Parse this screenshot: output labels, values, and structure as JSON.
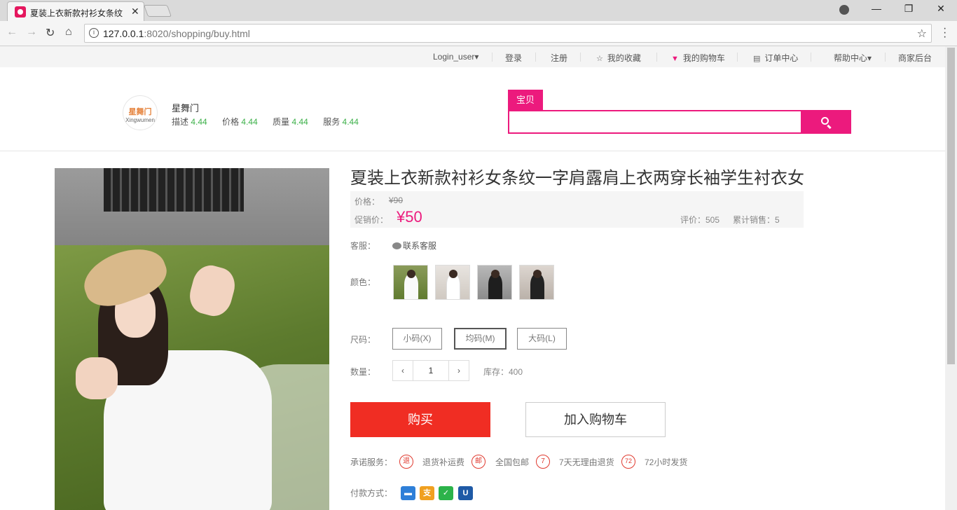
{
  "browser": {
    "tab_title": "夏装上衣新款衬衫女条纹",
    "url_host": "127.0.0.1",
    "url_path": ":8020/shopping/buy.html",
    "window_controls": {
      "minimize": "—",
      "restore": "❐",
      "close": "✕"
    }
  },
  "topnav": {
    "user": "Login_user▾",
    "login": "登录",
    "register": "注册",
    "favorites": "我的收藏",
    "cart": "我的购物车",
    "orders": "订单中心",
    "help": "帮助中心▾",
    "merchant": "商家后台"
  },
  "shop": {
    "logo_cn": "星舞门",
    "logo_en": "Xingwumen",
    "name": "星舞门",
    "ratings": [
      {
        "label": "描述",
        "value": "4.44"
      },
      {
        "label": "价格",
        "value": "4.44"
      },
      {
        "label": "质量",
        "value": "4.44"
      },
      {
        "label": "服务",
        "value": "4.44"
      }
    ]
  },
  "search": {
    "tab_label": "宝贝",
    "value": "",
    "placeholder": "",
    "accent": "#ec1a7d"
  },
  "product": {
    "title": "夏装上衣新款衬衫女条纹一字肩露肩上衣两穿长袖学生衬衣女",
    "price_label": "价格：",
    "original_price": "¥90",
    "promo_label": "促销价：",
    "promo_price": "¥50",
    "evaluation": "评价：505",
    "sales": "累计销售：5",
    "service_label": "客服：",
    "service_link": "联系客服",
    "color_label": "颜色：",
    "colors": [
      "white-1",
      "white-2",
      "black-1",
      "black-2"
    ],
    "size_label": "尺码：",
    "sizes": [
      {
        "label": "小码(X)",
        "selected": false
      },
      {
        "label": "均码(M)",
        "selected": true
      },
      {
        "label": "大码(L)",
        "selected": false
      }
    ],
    "qty_label": "数量：",
    "qty_dec": "‹",
    "qty_inc": "›",
    "quantity": "1",
    "stock": "库存：400",
    "buy_label": "购买",
    "cart_label": "加入购物车",
    "promise_label": "承诺服务：",
    "promises": [
      {
        "icon": "退",
        "text": "退货补运费"
      },
      {
        "icon": "邮",
        "text": "全国包邮"
      },
      {
        "icon": "7",
        "text": "7天无理由退货"
      },
      {
        "icon": "72",
        "text": "72小时发货"
      }
    ],
    "pay_label": "付款方式：",
    "pay_methods": [
      {
        "icon": "card-icon",
        "color": "#2e7fd8",
        "glyph": "▬"
      },
      {
        "icon": "alipay-icon",
        "color": "#f0a020",
        "glyph": "支"
      },
      {
        "icon": "wechat-pay-icon",
        "color": "#2cb34a",
        "glyph": "✓"
      },
      {
        "icon": "unionpay-icon",
        "color": "#1f5aa6",
        "glyph": "U"
      }
    ]
  }
}
